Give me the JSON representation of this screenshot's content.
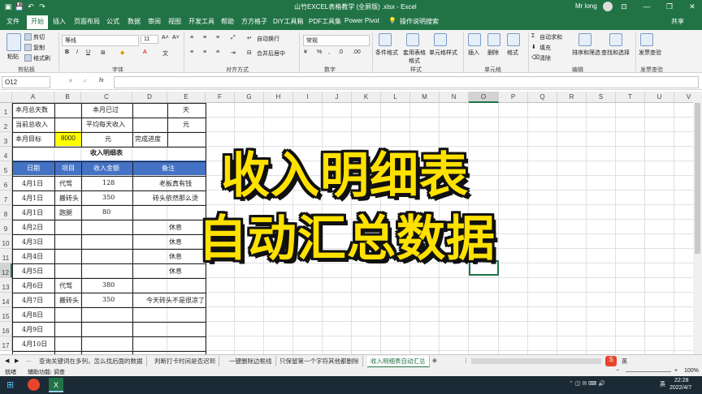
{
  "window": {
    "title": "山竹EXCEL表格教学 (全屏版) .xlsx - Excel",
    "user": "Mr long"
  },
  "tabs": [
    "文件",
    "开始",
    "插入",
    "页面布局",
    "公式",
    "数据",
    "审阅",
    "视图",
    "开发工具",
    "帮助",
    "方方格子",
    "DIY工具箱",
    "PDF工具集",
    "Power Pivot"
  ],
  "tell_me": "操作说明搜索",
  "share": "共享",
  "ribbon": {
    "clipboard": {
      "cut": "剪切",
      "copy": "复制",
      "format_painter": "格式刷",
      "paste": "粘贴",
      "label": "剪贴板"
    },
    "font": {
      "name": "等线",
      "size": "11",
      "label": "字体"
    },
    "alignment": {
      "wrap": "自动换行",
      "merge": "合并后居中",
      "label": "对齐方式"
    },
    "number": {
      "format": "常规",
      "label": "数字"
    },
    "styles": {
      "cond": "条件格式",
      "table": "套用表格格式",
      "cell": "单元格样式",
      "label": "样式"
    },
    "cells": {
      "insert": "插入",
      "delete": "删除",
      "format": "格式",
      "label": "单元格"
    },
    "editing": {
      "autosum": "自动求和",
      "fill": "填充",
      "clear": "清除",
      "sort": "排序和筛选",
      "find": "查找和选择",
      "label": "编辑"
    },
    "invoice": {
      "check": "发票查验",
      "label": "发票查验"
    }
  },
  "formula_bar": {
    "name_box": "O12",
    "formula": ""
  },
  "columns": [
    "A",
    "B",
    "C",
    "D",
    "E",
    "F",
    "G",
    "H",
    "I",
    "J",
    "K",
    "L",
    "M",
    "N",
    "O",
    "P",
    "Q",
    "R",
    "S",
    "T",
    "U",
    "V"
  ],
  "rows": [
    "1",
    "2",
    "3",
    "4",
    "5",
    "6",
    "7",
    "8",
    "9",
    "10",
    "11",
    "12",
    "13",
    "14",
    "15",
    "16",
    "17"
  ],
  "cells": {
    "a1": "本月总天数",
    "c1": "本月已过",
    "e1": "天",
    "a2": "当前总收入",
    "c2": "平均每天收入",
    "e2": "元",
    "a3": "本月目标",
    "b3": "8000",
    "c3": "元",
    "d3": "完成进度",
    "title": "收入明细表",
    "h_date": "日期",
    "h_item": "项目",
    "h_amount": "收入金额",
    "h_note": "备注",
    "r6": [
      "4月1日",
      "代驾",
      "128",
      "老板真有钱"
    ],
    "r7": [
      "4月1日",
      "搬砖头",
      "350",
      "砖头依然那么烫"
    ],
    "r8": [
      "4月1日",
      "跑腿",
      "80",
      ""
    ],
    "r9": [
      "4月2日",
      "",
      "",
      "休息"
    ],
    "r10": [
      "4月3日",
      "",
      "",
      "休息"
    ],
    "r11": [
      "4月4日",
      "",
      "",
      "休息"
    ],
    "r12": [
      "4月5日",
      "",
      "",
      "休息"
    ],
    "r13": [
      "4月6日",
      "代驾",
      "380",
      ""
    ],
    "r14": [
      "4月7日",
      "搬砖头",
      "350",
      "今天砖头不是很凉了"
    ],
    "r15": [
      "4月8日",
      "",
      "",
      ""
    ],
    "r16": [
      "4月9日",
      "",
      "",
      ""
    ],
    "r17": [
      "4月10日",
      "",
      "",
      ""
    ]
  },
  "overlay": {
    "line1": "收入明细表",
    "line2": "自动汇总数据"
  },
  "sheet_tabs": [
    "查询关键词在多列，怎么找后面的数据",
    "判断打卡时间是否迟到",
    "一键删除边框线",
    "只保留第一个字符其他都删除",
    "收入明细表自动汇总"
  ],
  "status": {
    "ready": "就绪",
    "accessibility": "辅助功能: 调查",
    "zoom": "100%"
  },
  "taskbar": {
    "time": "22:28",
    "date": "2022/4/7",
    "ime": "英"
  },
  "colors": {
    "excel_green": "#217346",
    "header_blue": "#4472c4",
    "target_yellow": "#ffff00",
    "overlay_yellow": "#ffe100"
  }
}
